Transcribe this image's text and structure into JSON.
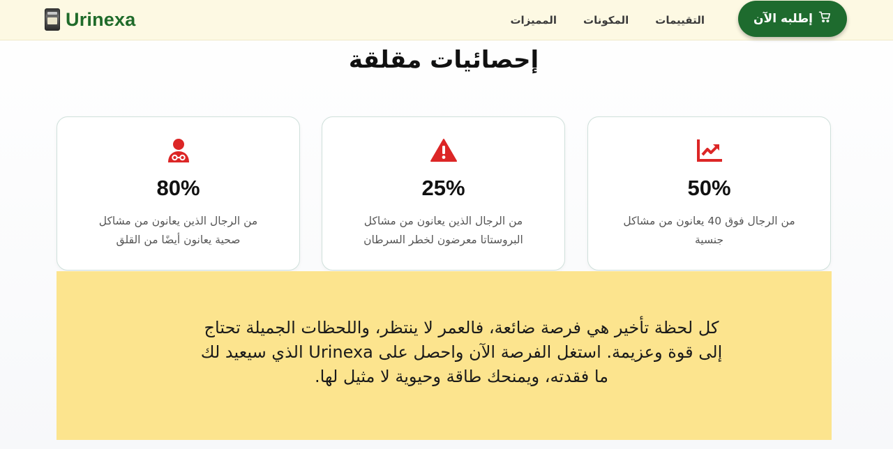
{
  "nav": {
    "brand": "Urinexa",
    "links": [
      "التقييمات",
      "المكونات",
      "المميزات"
    ],
    "order_button": "إطلبه الآن"
  },
  "stats": {
    "title": "إحصائيات مقلقة",
    "cards": [
      {
        "icon": "chart-line-up-icon",
        "value": "50%",
        "text": "من الرجال فوق 40 يعانون من مشاكل جنسية"
      },
      {
        "icon": "warning-triangle-icon",
        "value": "25%",
        "text": "من الرجال الذين يعانون من مشاكل البروستاتا معرضون لخطر السرطان"
      },
      {
        "icon": "user-doctor-icon",
        "value": "80%",
        "text": "من الرجال الذين يعانون من مشاكل صحية يعانون أيضًا من القلق"
      }
    ]
  },
  "quote": {
    "text": "كل لحظة تأخير هي فرصة ضائعة، فالعمر لا ينتظر، واللحظات الجميلة تحتاج إلى قوة وعزيمة. استغل الفرصة الآن واحصل على Urinexa الذي سيعيد لك ما فقدته، ويمنحك طاقة وحيوية لا مثيل لها."
  },
  "colors": {
    "brand_green": "#1e6b2e",
    "icon_red": "#dc2626",
    "nav_bg": "#fdf9e3",
    "quote_bg": "#fce48e"
  }
}
